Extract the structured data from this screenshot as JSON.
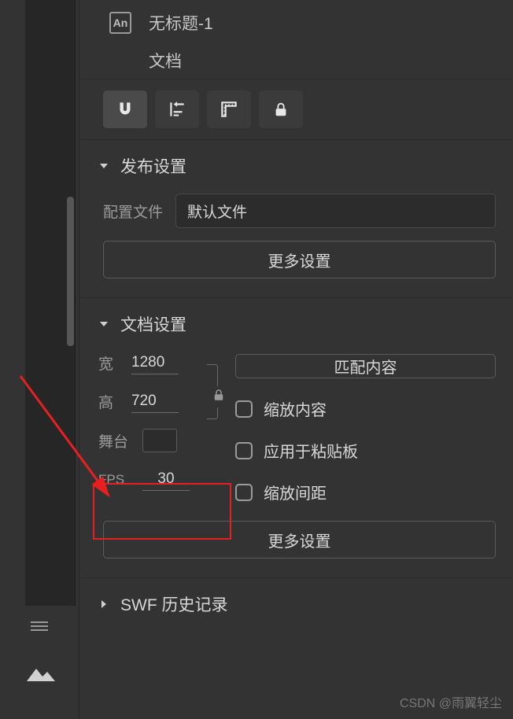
{
  "header": {
    "badge": "An",
    "title": "无标题-1",
    "subtitle": "文档"
  },
  "publish": {
    "title": "发布设置",
    "profile_label": "配置文件",
    "profile_value": "默认文件",
    "more": "更多设置"
  },
  "document": {
    "title": "文档设置",
    "width_label": "宽",
    "width_value": "1280",
    "height_label": "高",
    "height_value": "720",
    "match_content": "匹配内容",
    "stage_label": "舞台",
    "fps_label": "FPS",
    "fps_value": "30",
    "scale_content": "缩放内容",
    "apply_pasteboard": "应用于粘贴板",
    "scale_spacing": "缩放间距",
    "more": "更多设置"
  },
  "swf": {
    "title": "SWF 历史记录"
  },
  "watermark": "CSDN @雨翼轻尘"
}
